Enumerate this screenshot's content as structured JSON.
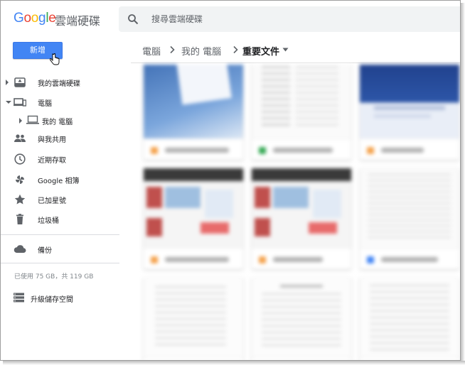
{
  "header": {
    "logo": [
      "G",
      "o",
      "o",
      "g",
      "l",
      "e"
    ],
    "logo_colors": [
      "#4285f4",
      "#ea4335",
      "#fbbc05",
      "#4285f4",
      "#34a853",
      "#ea4335"
    ],
    "product": "雲端硬碟",
    "search_placeholder": "搜尋雲端硬碟"
  },
  "sidebar": {
    "new_button": "新增",
    "items": [
      {
        "label": "我的雲端硬碟",
        "icon": "drive-icon"
      },
      {
        "label": "電腦",
        "icon": "computers-icon"
      },
      {
        "label": "我的 電腦",
        "icon": "laptop-icon"
      },
      {
        "label": "與我共用",
        "icon": "shared-people-icon"
      },
      {
        "label": "近期存取",
        "icon": "clock-icon"
      },
      {
        "label": "Google 相簿",
        "icon": "photos-pinwheel-icon"
      },
      {
        "label": "已加星號",
        "icon": "star-icon"
      },
      {
        "label": "垃圾桶",
        "icon": "trash-icon"
      },
      {
        "label": "備份",
        "icon": "cloud-icon"
      }
    ],
    "storage": "已使用 75 GB，共 119 GB",
    "upgrade": "升級儲存空間"
  },
  "breadcrumb": [
    "電腦",
    "我的 電腦",
    "重要文件"
  ],
  "colors": {
    "accent": "#4285f4",
    "file_doc": "#4285f4",
    "file_slides": "#f4a14b",
    "file_sheets": "#34a853"
  }
}
